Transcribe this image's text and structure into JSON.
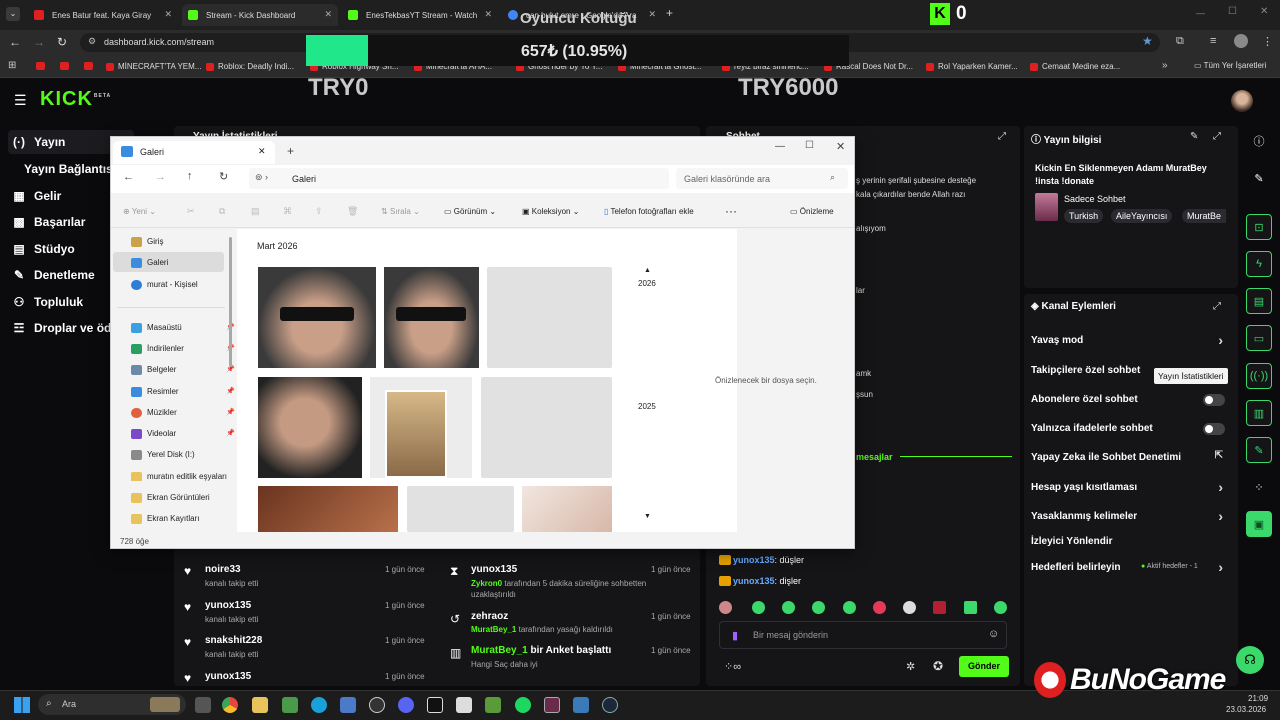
{
  "browser": {
    "tabs": [
      {
        "label": "Enes Batur feat. Kaya Giray",
        "color": "#e02020"
      },
      {
        "label": "Stream - Kick Dashboard",
        "color": "#53fc18",
        "active": true
      },
      {
        "label": "EnesTekbasYT Stream - Watch",
        "color": "#53fc18"
      },
      {
        "label": "can bulut emre - Google'da Ara",
        "color": "#4285f4"
      }
    ],
    "url": "dashboard.kick.com/stream",
    "bookmarks": [
      "MİNECRAFT'TA YEM...",
      "Roblox: Deadly Indi...",
      "Roblox Highway Sh...",
      "Minecraft'ta AHA...",
      "Ghost rider by Yo Y...",
      "Minecraft'ta Ghost...",
      "reyiz biraz sinirlenc...",
      "Rascal Does Not Dr...",
      "Rol Yaparken Kamer...",
      "Cemaat Medine eza...",
      "Tüm Yer İşaretleri"
    ]
  },
  "overlay": {
    "score": "0",
    "title": "Oyuncu Koltuğu",
    "progress_text": "657₺ (10.95%)",
    "progress_fraction": 0.1095,
    "left_label": "TRY0",
    "right_label": "TRY6000",
    "watermark": "BuNoGame"
  },
  "kick": {
    "logo": "KICK",
    "beta": "BETA",
    "sidebar": [
      "Yayın",
      "Yayın Bağlantısı",
      "Gelir",
      "Başarılar",
      "Stüdyo",
      "Denetleme",
      "Topluluk",
      "Droplar ve ödül"
    ],
    "stats_title": "Yayın İstatistikleri",
    "chat_title": "Sohbet",
    "chat_lines": [
      "ş yerinin şerifali şubesine desteğe",
      "kala çıkardılar bende Allah razı",
      "alışıyom",
      "lar",
      "amk",
      "şsun"
    ],
    "chat_green_label": "mesajlar",
    "stream_info": {
      "title": "Yayın bilgisi",
      "stream_title": "Kickin En Siklenmeyen Adamı MuratBey !insta !donate",
      "category": "Sadece Sohbet",
      "tags": [
        "Turkish",
        "AileYayıncısı",
        "MuratBe"
      ]
    },
    "channel_actions": {
      "title": "Kanal Eylemleri",
      "items": [
        "Yavaş mod",
        "Takipçilere özel sohbet",
        "Abonelere özel sohbet",
        "Yalnızca ifadelerle sohbet",
        "Yapay Zeka ile Sohbet Denetimi",
        "Hesap yaşı kısıtlaması",
        "Yasaklanmış kelimeler",
        "İzleyici Yönlendir",
        "Hedefleri belirleyin"
      ],
      "goal_status": "Aktif hedefler - 1"
    },
    "tooltip": "Yayın İstatistikleri",
    "feed_left": [
      {
        "name": "noire33",
        "sub": "kanalı takip etti",
        "time": "1 gün önce"
      },
      {
        "name": "yunox135",
        "sub": "kanalı takip etti",
        "time": "1 gün önce"
      },
      {
        "name": "snakshit228",
        "sub": "kanalı takip etti",
        "time": "1 gün önce"
      },
      {
        "name": "yunox135",
        "sub": "",
        "time": "1 gün önce"
      }
    ],
    "feed_mid": [
      {
        "name": "yunox135",
        "actor": "Zykron0",
        "sub": "tarafından 5 dakika süreliğine sohbetten uzaklaştırıldı",
        "time": "1 gün önce"
      },
      {
        "name": "zehraoz",
        "actor": "MuratBey_1",
        "sub": "tarafından yasağı kaldırıldı",
        "time": "1 gün önce"
      },
      {
        "name": "MuratBey_1",
        "extra": "bir Anket başlattı",
        "sub": "Hangi Saç daha iyi",
        "time": "1 gün önce"
      }
    ],
    "chat_messages": [
      {
        "user": "yunox135",
        "text": ": düşler"
      },
      {
        "user": "yunox135",
        "text": ": dişler"
      }
    ],
    "chat_placeholder": "Bir mesaj gönderin",
    "send_label": "Gönder"
  },
  "explorer": {
    "title": "Galeri",
    "address": "Galeri",
    "search_placeholder": "Galeri klasöründe ara",
    "toolbar": [
      "Yeni",
      "Sırala",
      "Görünüm",
      "Koleksiyon",
      "Telefon fotoğrafları ekle",
      "Önizleme"
    ],
    "nav": [
      "Giriş",
      "Galeri",
      "murat - Kişisel",
      "Masaüstü",
      "İndirilenler",
      "Belgeler",
      "Resimler",
      "Müzikler",
      "Videolar",
      "Yerel Disk (I:)",
      "muratın editlik eşyaları",
      "Ekran Görüntüleri",
      "Ekran Kayıtları"
    ],
    "section": "Mart 2026",
    "years": [
      "2026",
      "2025"
    ],
    "preview_text": "Önizlenecek bir dosya seçin.",
    "status": "728 öğe"
  },
  "taskbar": {
    "search": "Ara",
    "time": "21:09",
    "date": "23.03.2026"
  }
}
